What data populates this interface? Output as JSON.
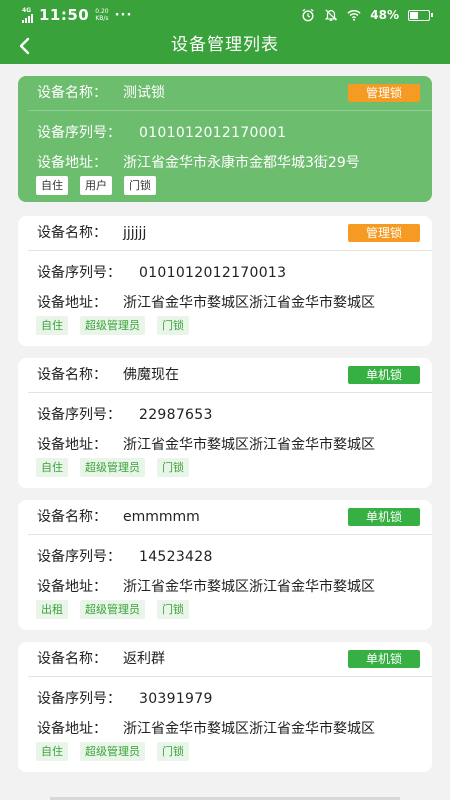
{
  "status": {
    "network": "4G",
    "time": "11:50",
    "speed_value": "0.20",
    "speed_unit": "KB/s",
    "more": "···",
    "battery": "48%"
  },
  "header": {
    "title": "设备管理列表"
  },
  "labels": {
    "name": "设备名称：",
    "serial": "设备序列号：",
    "address": "设备地址："
  },
  "devices": [
    {
      "name": "测试锁",
      "type": "管理锁",
      "serial": "0101012012170001",
      "address": "浙江省金华市永康市金都华城3街29号",
      "tags": [
        "自住",
        "用户",
        "门锁"
      ]
    },
    {
      "name": "jjjjjj",
      "type": "管理锁",
      "serial": "0101012012170013",
      "address": "浙江省金华市婺城区浙江省金华市婺城区",
      "tags": [
        "自住",
        "超级管理员",
        "门锁"
      ]
    },
    {
      "name": "佛魔现在",
      "type": "单机锁",
      "serial": "22987653",
      "address": "浙江省金华市婺城区浙江省金华市婺城区",
      "tags": [
        "自住",
        "超级管理员",
        "门锁"
      ]
    },
    {
      "name": "emmmmm",
      "type": "单机锁",
      "serial": "14523428",
      "address": "浙江省金华市婺城区浙江省金华市婺城区",
      "tags": [
        "出租",
        "超级管理员",
        "门锁"
      ]
    },
    {
      "name": "返利群",
      "type": "单机锁",
      "serial": "30391979",
      "address": "浙江省金华市婺城区浙江省金华市婺城区",
      "tags": [
        "自住",
        "超级管理员",
        "门锁"
      ]
    }
  ],
  "colors": {
    "primary": "#3aa23a",
    "selected_card": "#6dbd6f",
    "badge_manage": "#f59a22",
    "badge_standalone": "#36b043"
  },
  "icons": {
    "back": "back-arrow-icon",
    "alarm": "alarm-icon",
    "mute": "bell-off-icon",
    "wifi": "wifi-icon",
    "battery": "battery-icon",
    "battery_level": 0.48
  }
}
